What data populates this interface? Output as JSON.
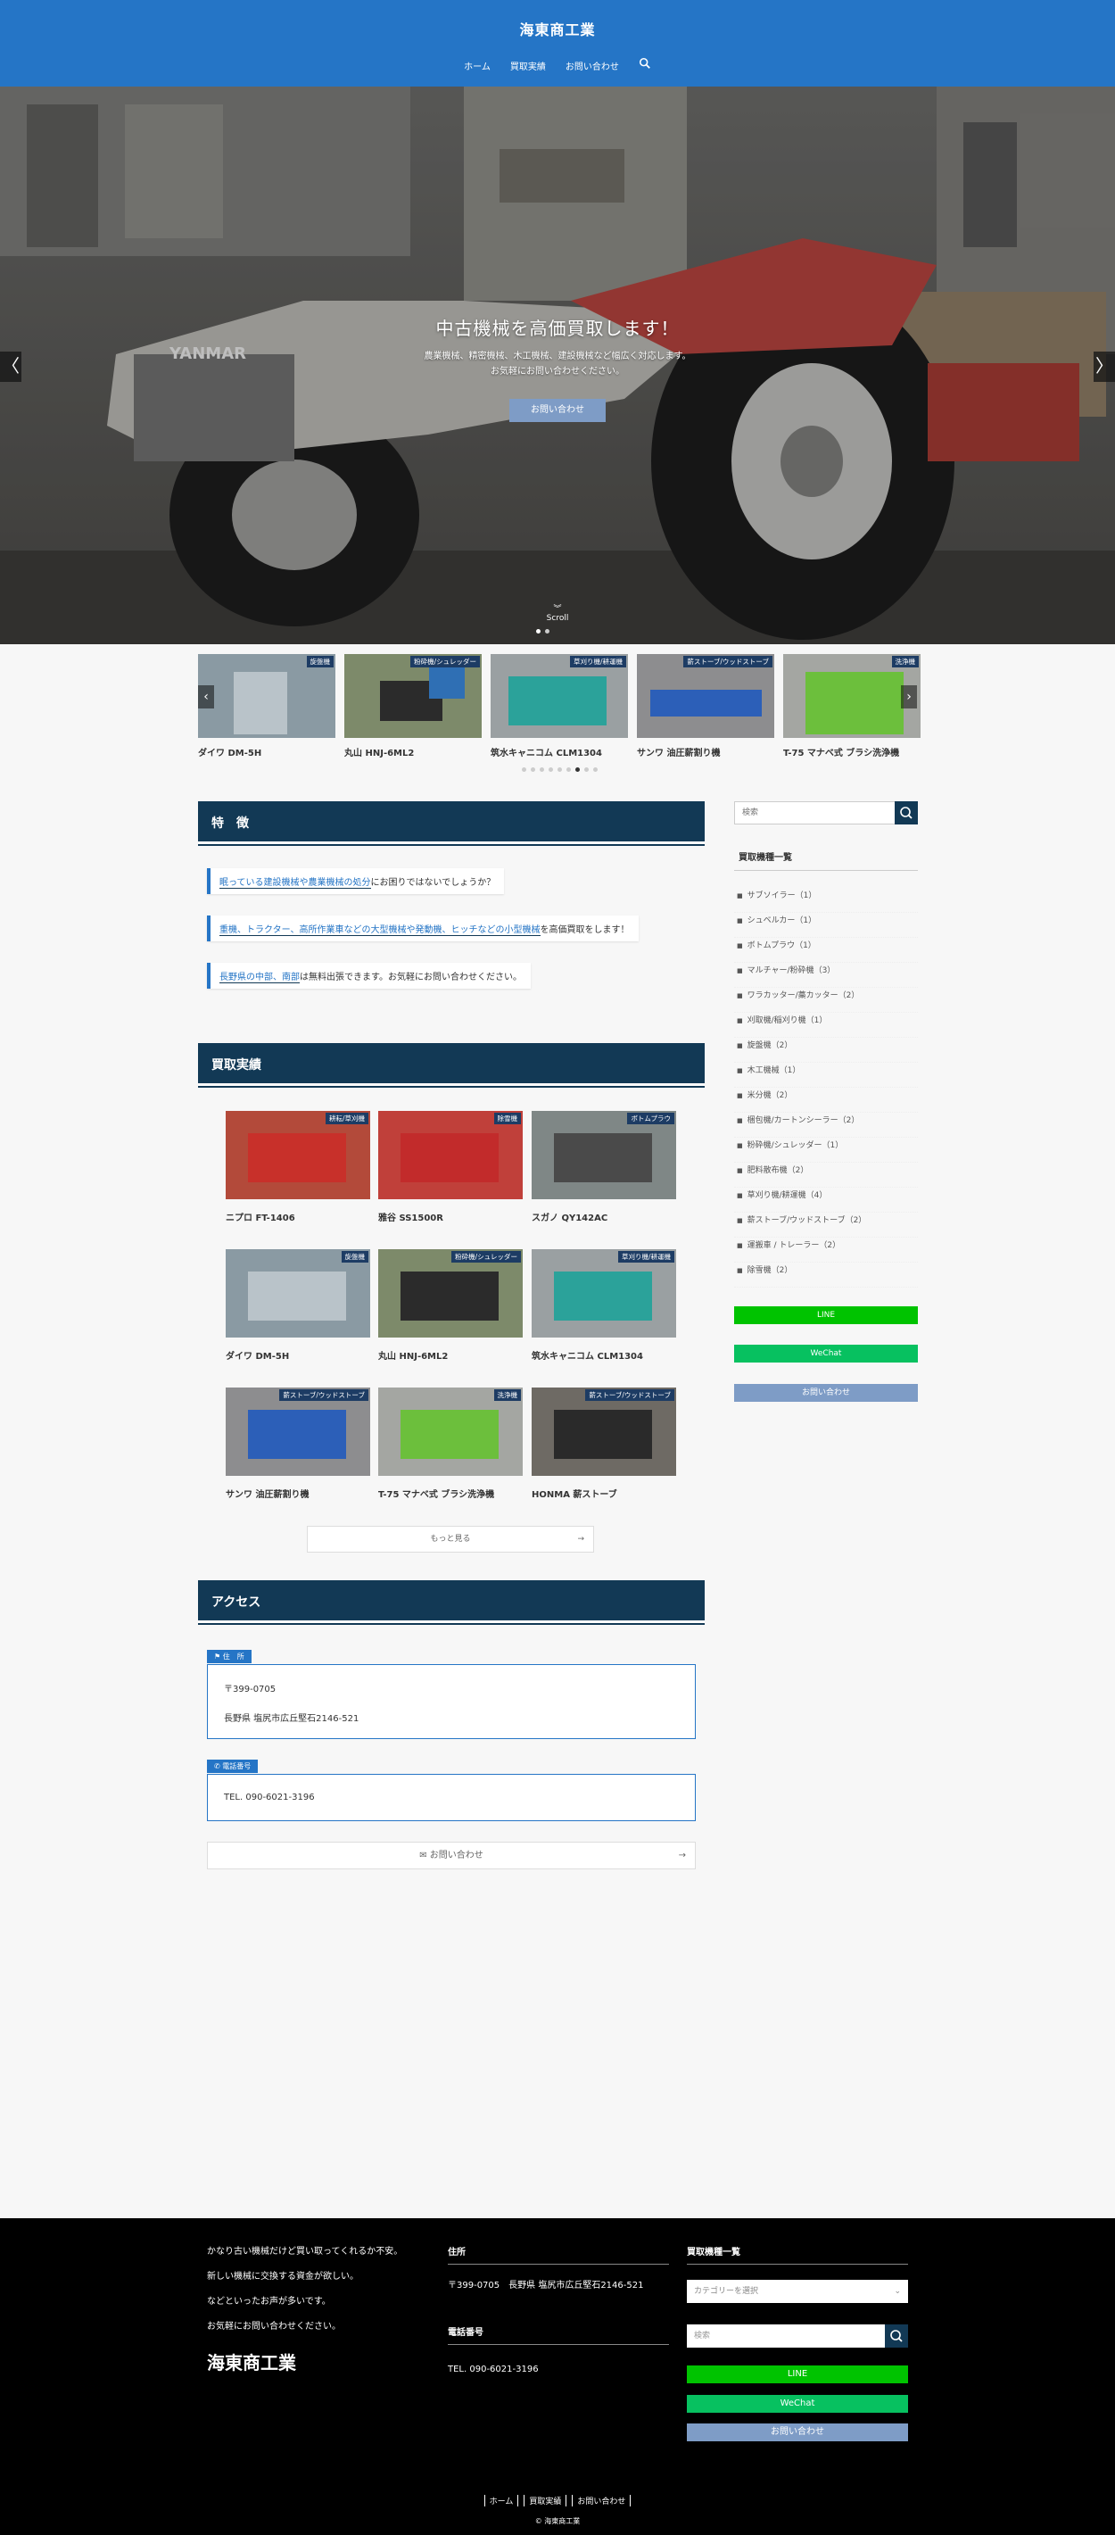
{
  "header": {
    "title": "海東商工業",
    "nav": [
      "ホーム",
      "買取実績",
      "お問い合わせ"
    ]
  },
  "hero": {
    "heading": "中古機械を高価買取します！",
    "sub1": "農業機械、精密機械、木工機械、建設機械など幅広く対応します。",
    "sub2": "お気軽にお問い合わせください。",
    "button": "お問い合わせ",
    "scroll": "Scroll",
    "prev": "〈",
    "next": "〉"
  },
  "carousel": {
    "items": [
      {
        "cap": "ダイワ DM-5H",
        "badge": "旋盤機"
      },
      {
        "cap": "丸山 HNJ-6ML2",
        "badge": "粉砕機/シュレッダー"
      },
      {
        "cap": "筑水キャニコム CLM1304",
        "badge": "草刈り機/耕運機"
      },
      {
        "cap": "サンワ 油圧薪割り機",
        "badge": "薪ストーブ/ウッドストーブ"
      },
      {
        "cap": "T-75 マナベ式 ブラシ洗浄機",
        "badge": "洗浄機"
      }
    ]
  },
  "features": {
    "heading": "特　徴",
    "items": [
      {
        "em": "眠っている建設機械や農業機械の処分",
        "rest": "にお困りではないでしょうか？"
      },
      {
        "em": "重機、トラクター、高所作業車などの大型機械や発動機、ヒッチなどの小型機械",
        "rest": "を高価買取をします！"
      },
      {
        "em": "長野県の中部、南部",
        "rest": "は無料出張できます。お気軽にお問い合わせください。"
      }
    ]
  },
  "results": {
    "heading": "買取実績",
    "more": "もっと見る",
    "items": [
      {
        "cap": "ニプロ FT-1406",
        "badge": "耕耘/草刈機"
      },
      {
        "cap": "雅谷 SS1500R",
        "badge": "除雪機"
      },
      {
        "cap": "スガノ QY142AC",
        "badge": "ボトムプラウ"
      },
      {
        "cap": "ダイワ DM-5H",
        "badge": "旋盤機"
      },
      {
        "cap": "丸山 HNJ-6ML2",
        "badge": "粉砕機/シュレッダー"
      },
      {
        "cap": "筑水キャニコム CLM1304",
        "badge": "草刈り機/耕運機"
      },
      {
        "cap": "サンワ 油圧薪割り機",
        "badge": "薪ストーブ/ウッドストーブ"
      },
      {
        "cap": "T-75 マナベ式 ブラシ洗浄機",
        "badge": "洗浄機"
      },
      {
        "cap": "HONMA 薪ストーブ",
        "badge": "薪ストーブ/ウッドストーブ"
      }
    ]
  },
  "access": {
    "heading": "アクセス",
    "addr_label": "住　所",
    "zip": "〒399-0705",
    "addr": "長野県 塩尻市広丘堅石2146-521",
    "tel_label": "電話番号",
    "tel": "TEL. 090-6021-3196",
    "contact": "お問い合わせ"
  },
  "sidebar": {
    "search_ph": "検索",
    "title": "買取機種一覧",
    "cats": [
      "サブソイラー（1）",
      "シュベルカー（1）",
      "ボトムプラウ（1）",
      "マルチャー/粉砕機（3）",
      "ワラカッター/藁カッター（2）",
      "刈取機/稲刈り機（1）",
      "旋盤機（2）",
      "木工機械（1）",
      "米分機（2）",
      "梱包機/カートンシーラー（2）",
      "粉砕機/シュレッダー（1）",
      "肥料散布機（2）",
      "草刈り機/耕運機（4）",
      "薪ストーブ/ウッドストーブ（2）",
      "運搬車 / トレーラー（2）",
      "除雪機（2）"
    ],
    "line": "LINE",
    "wechat": "WeChat",
    "contact": "お問い合わせ"
  },
  "footer": {
    "lines": [
      "かなり古い機械だけど買い取ってくれるか不安。",
      "新しい機械に交換する資金が欲しい。",
      "などといったお声が多いです。",
      "お気軽にお問い合わせください。"
    ],
    "brand": "海東商工業",
    "addr_h": "住所",
    "addr": "〒399-0705　長野県 塩尻市広丘堅石2146-521",
    "tel_h": "電話番号",
    "tel": "TEL. 090-6021-3196",
    "cat_h": "買取機種一覧",
    "select": "カテゴリーを選択",
    "search_ph": "検索",
    "line": "LINE",
    "wechat": "WeChat",
    "contact": "お問い合わせ",
    "nav": [
      "ホーム",
      "買取実績",
      "お問い合わせ"
    ],
    "copy": "© 海東商工業"
  },
  "colors": {
    "brand": "#2575c6",
    "dark": "#123955",
    "line": "#00c300",
    "wechat": "#07c160",
    "contact": "#7e9cc6"
  }
}
